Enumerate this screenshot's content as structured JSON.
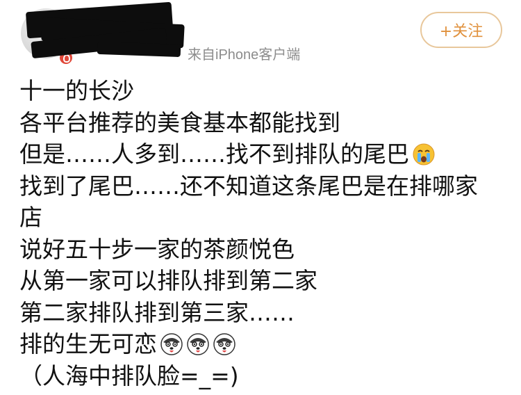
{
  "header": {
    "username": "",
    "source": "来自iPhone客户端",
    "follow_label": "+关注"
  },
  "post": {
    "lines": [
      "十一的长沙",
      "各平台推荐的美食基本都能找到",
      "但是……人多到……找不到排队的尾巴",
      "找到了尾巴……还不知道这条尾巴是在排哪家",
      "店",
      "说好五十步一家的茶颜悦色",
      "从第一家可以排队排到第二家",
      "第二家排队排到第三家……",
      "排的生无可恋",
      "（人海中排队脸=_=)"
    ],
    "emojis": {
      "line_3": "crying-face-icon",
      "line_9": [
        "husky-face-icon",
        "husky-face-icon",
        "husky-face-icon"
      ]
    }
  },
  "colors": {
    "text": "#111111",
    "meta_text": "#8c8c8c",
    "follow_border": "#e8c79b",
    "follow_text": "#e0913d"
  }
}
